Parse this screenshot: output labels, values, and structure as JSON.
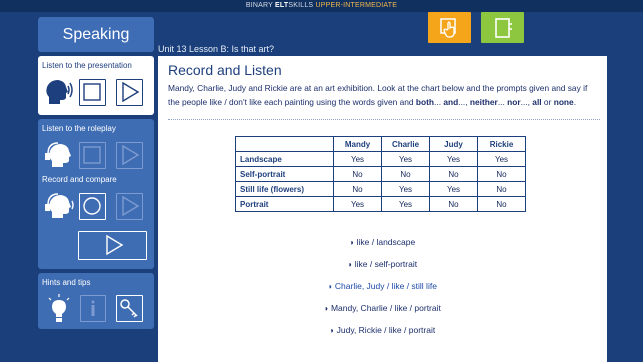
{
  "topbar": {
    "brand": "BINARY",
    "elt": "ELT",
    "skills": "SKILLS",
    "level": "UPPER-INTERMEDIATE"
  },
  "header": {
    "section_button": "Speaking",
    "lesson_title": "Unit 13 Lesson B: Is that art?"
  },
  "sidebar": {
    "presentation_label": "Listen to the presentation",
    "roleplay_label": "Listen to the roleplay",
    "record_label": "Record and compare",
    "hints_label": "Hints and tips"
  },
  "main": {
    "title": "Record and Listen",
    "instruction_part1": "Mandy, Charlie, Judy and Rickie are at an art exhibition. Look at the chart below and the prompts given and say if the people like / don't like each painting using the words given and",
    "instruction_both": "both",
    "instruction_and": "and",
    "instruction_neither": "neither",
    "instruction_nor": "nor",
    "instruction_all": "all",
    "instruction_or": "or",
    "instruction_none": "none",
    "table": {
      "headers": [
        "",
        "Mandy",
        "Charlie",
        "Judy",
        "Rickie"
      ],
      "rows": [
        [
          "Landscape",
          "Yes",
          "Yes",
          "Yes",
          "Yes"
        ],
        [
          "Self-portrait",
          "No",
          "No",
          "No",
          "No"
        ],
        [
          "Still life (flowers)",
          "No",
          "Yes",
          "Yes",
          "No"
        ],
        [
          "Portrait",
          "Yes",
          "Yes",
          "No",
          "No"
        ]
      ]
    },
    "prompts": [
      "like / landscape",
      "like / self-portrait",
      "Charlie, Judy / like / still life",
      "Mandy, Charlie / like / portrait",
      "Judy, Rickie / like / portrait"
    ],
    "bullet": "◗"
  },
  "colors": {
    "background": "#1a3f7a",
    "accent_orange": "#f5a51a",
    "accent_green": "#8dc63f",
    "panel_blue": "#3f6db4"
  }
}
